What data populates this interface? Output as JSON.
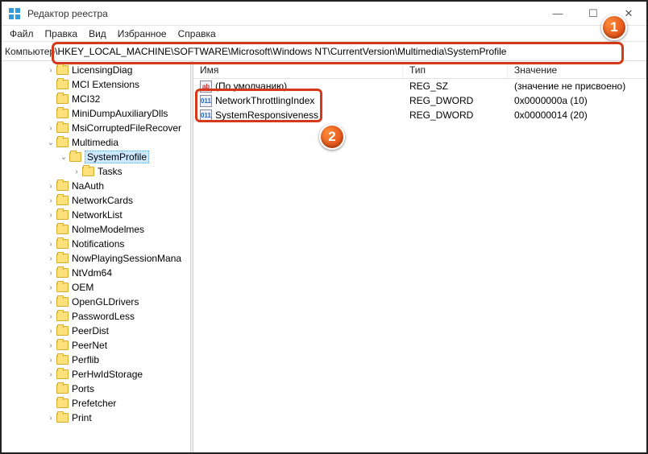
{
  "window": {
    "title": "Редактор реестра"
  },
  "menu": {
    "file": "Файл",
    "edit": "Правка",
    "view": "Вид",
    "fav": "Избранное",
    "help": "Справка"
  },
  "address": {
    "label": "Компьютер",
    "path": "\\HKEY_LOCAL_MACHINE\\SOFTWARE\\Microsoft\\Windows NT\\CurrentVersion\\Multimedia\\SystemProfile"
  },
  "tree": {
    "items": [
      {
        "label": "LicensingDiag",
        "indent": 3,
        "chev": "right"
      },
      {
        "label": "MCI Extensions",
        "indent": 3,
        "chev": ""
      },
      {
        "label": "MCI32",
        "indent": 3,
        "chev": ""
      },
      {
        "label": "MiniDumpAuxiliaryDlls",
        "indent": 3,
        "chev": ""
      },
      {
        "label": "MsiCorruptedFileRecover",
        "indent": 3,
        "chev": "right"
      },
      {
        "label": "Multimedia",
        "indent": 3,
        "chev": "down"
      },
      {
        "label": "SystemProfile",
        "indent": 4,
        "chev": "down",
        "selected": true
      },
      {
        "label": "Tasks",
        "indent": 5,
        "chev": "right"
      },
      {
        "label": "NaAuth",
        "indent": 3,
        "chev": "right"
      },
      {
        "label": "NetworkCards",
        "indent": 3,
        "chev": "right"
      },
      {
        "label": "NetworkList",
        "indent": 3,
        "chev": "right"
      },
      {
        "label": "NolmeModelmes",
        "indent": 3,
        "chev": ""
      },
      {
        "label": "Notifications",
        "indent": 3,
        "chev": "right"
      },
      {
        "label": "NowPlayingSessionMana",
        "indent": 3,
        "chev": "right"
      },
      {
        "label": "NtVdm64",
        "indent": 3,
        "chev": "right"
      },
      {
        "label": "OEM",
        "indent": 3,
        "chev": "right"
      },
      {
        "label": "OpenGLDrivers",
        "indent": 3,
        "chev": "right"
      },
      {
        "label": "PasswordLess",
        "indent": 3,
        "chev": "right"
      },
      {
        "label": "PeerDist",
        "indent": 3,
        "chev": "right"
      },
      {
        "label": "PeerNet",
        "indent": 3,
        "chev": "right"
      },
      {
        "label": "Perflib",
        "indent": 3,
        "chev": "right"
      },
      {
        "label": "PerHwIdStorage",
        "indent": 3,
        "chev": "right"
      },
      {
        "label": "Ports",
        "indent": 3,
        "chev": ""
      },
      {
        "label": "Prefetcher",
        "indent": 3,
        "chev": ""
      },
      {
        "label": "Print",
        "indent": 3,
        "chev": "right"
      }
    ]
  },
  "columns": {
    "name": "Имя",
    "type": "Тип",
    "value": "Значение"
  },
  "values": [
    {
      "name": "(По умолчанию)",
      "type": "REG_SZ",
      "value": "(значение не присвоено)",
      "icon": "ab"
    },
    {
      "name": "NetworkThrottlingIndex",
      "type": "REG_DWORD",
      "value": "0x0000000a (10)",
      "icon": "num"
    },
    {
      "name": "SystemResponsiveness",
      "type": "REG_DWORD",
      "value": "0x00000014 (20)",
      "icon": "num"
    }
  ],
  "badges": {
    "b1": "1",
    "b2": "2"
  }
}
